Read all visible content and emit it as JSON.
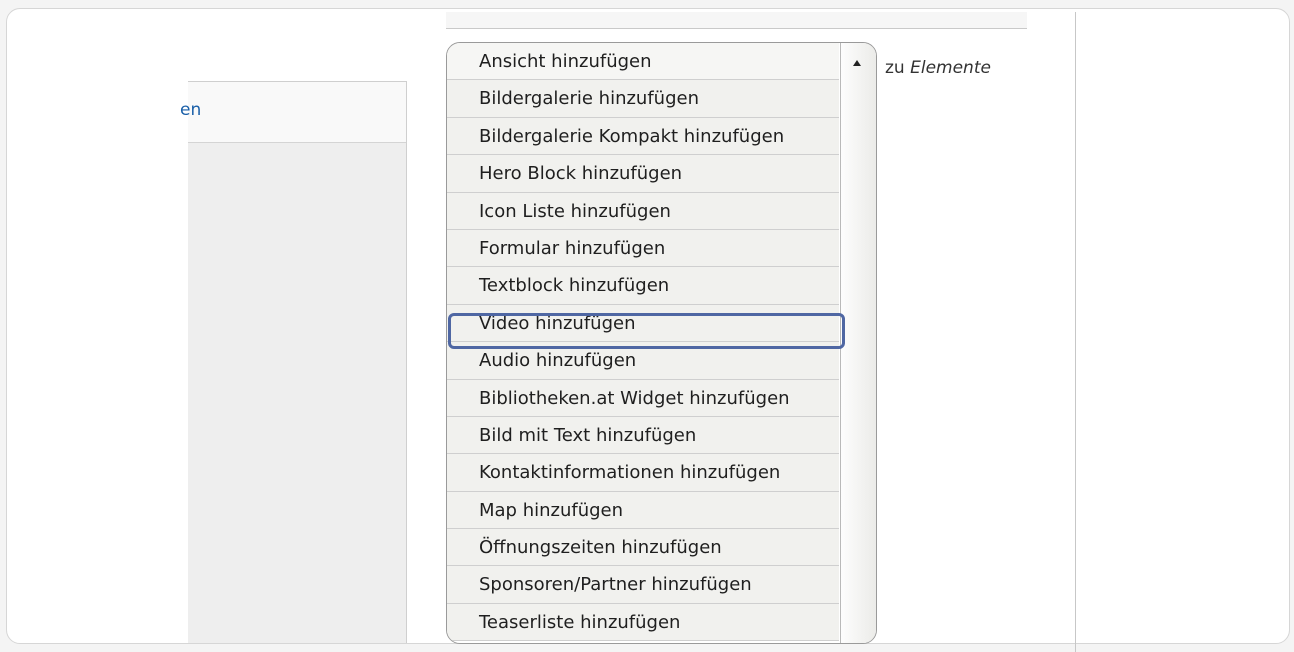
{
  "left": {
    "link_text": "en"
  },
  "dropdown": {
    "items": [
      "Ansicht hinzufügen",
      "Bildergalerie hinzufügen",
      "Bildergalerie Kompakt hinzufügen",
      "Hero Block hinzufügen",
      "Icon Liste hinzufügen",
      "Formular hinzufügen",
      "Textblock hinzufügen",
      "Video hinzufügen",
      "Audio hinzufügen",
      "Bibliotheken.at Widget hinzufügen",
      "Bild mit Text hinzufügen",
      "Kontaktinformationen hinzufügen",
      "Map hinzufügen",
      "Öffnungszeiten hinzufügen",
      "Sponsoren/Partner hinzufügen",
      "Teaserliste hinzufügen"
    ],
    "highlighted_index": 7
  },
  "suffix": {
    "prefix": "zu",
    "target": "Elemente"
  },
  "colors": {
    "highlight": "#4f67a3",
    "link": "#1a5fa8"
  },
  "icons": {
    "scroll_up": "triangle-up-icon"
  }
}
